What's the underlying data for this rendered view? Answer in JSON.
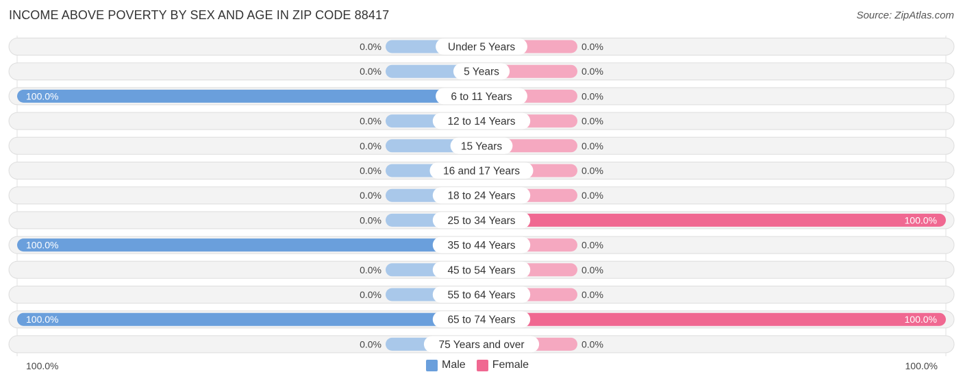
{
  "title": "INCOME ABOVE POVERTY BY SEX AND AGE IN ZIP CODE 88417",
  "source": "Source: ZipAtlas.com",
  "colors": {
    "male": "#6a9fdc",
    "male_light": "#a9c8ea",
    "female": "#f06891",
    "female_light": "#f5a8c0",
    "track": "#f3f3f3",
    "track_border": "#dddddd"
  },
  "chart_data": {
    "type": "bar",
    "orientation": "horizontal-diverging",
    "title": "INCOME ABOVE POVERTY BY SEX AND AGE IN ZIP CODE 88417",
    "categories": [
      "Under 5 Years",
      "5 Years",
      "6 to 11 Years",
      "12 to 14 Years",
      "15 Years",
      "16 and 17 Years",
      "18 to 24 Years",
      "25 to 34 Years",
      "35 to 44 Years",
      "45 to 54 Years",
      "55 to 64 Years",
      "65 to 74 Years",
      "75 Years and over"
    ],
    "series": [
      {
        "name": "Male",
        "values": [
          0.0,
          0.0,
          100.0,
          0.0,
          0.0,
          0.0,
          0.0,
          0.0,
          100.0,
          0.0,
          0.0,
          100.0,
          0.0
        ]
      },
      {
        "name": "Female",
        "values": [
          0.0,
          0.0,
          0.0,
          0.0,
          0.0,
          0.0,
          0.0,
          100.0,
          0.0,
          0.0,
          0.0,
          100.0,
          0.0
        ]
      }
    ],
    "value_labels": {
      "male": [
        "0.0%",
        "0.0%",
        "100.0%",
        "0.0%",
        "0.0%",
        "0.0%",
        "0.0%",
        "0.0%",
        "100.0%",
        "0.0%",
        "0.0%",
        "100.0%",
        "0.0%"
      ],
      "female": [
        "0.0%",
        "0.0%",
        "0.0%",
        "0.0%",
        "0.0%",
        "0.0%",
        "0.0%",
        "100.0%",
        "0.0%",
        "0.0%",
        "0.0%",
        "100.0%",
        "0.0%"
      ]
    },
    "xlim": [
      0,
      100
    ],
    "axis_labels": {
      "left": "100.0%",
      "right": "100.0%"
    },
    "legend": {
      "entries": [
        "Male",
        "Female"
      ],
      "position": "bottom-center"
    },
    "grid": false
  }
}
